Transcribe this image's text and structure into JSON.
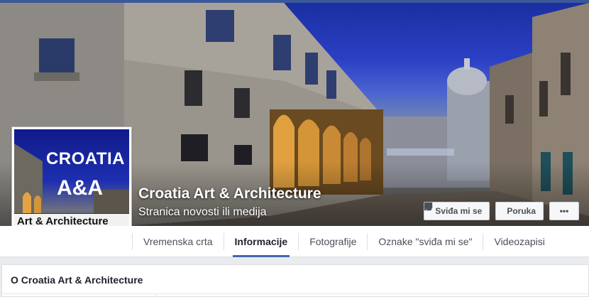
{
  "page": {
    "name": "Croatia Art & Architecture",
    "category": "Stranica novosti ili medija"
  },
  "profile_picture": {
    "line1": "CROATIA",
    "line2": "A&A",
    "line3": "Art & Architecture"
  },
  "actions": {
    "like_label": "Sviđa mi se",
    "message_label": "Poruka",
    "more_label": "•••"
  },
  "nav": {
    "tabs": [
      {
        "label": "Vremenska crta",
        "active": false
      },
      {
        "label": "Informacije",
        "active": true
      },
      {
        "label": "Fotografije",
        "active": false
      },
      {
        "label": "Oznake \"sviđa mi se\"",
        "active": false
      },
      {
        "label": "Videozapisi",
        "active": false
      }
    ]
  },
  "about": {
    "title": "O Croatia Art & Architecture"
  },
  "colors": {
    "brand_blue": "#3b5998",
    "active_tab_underline": "#4267b2"
  },
  "icons": {
    "like": "thumbs-up-icon",
    "message": "chat-bubble-icon"
  }
}
